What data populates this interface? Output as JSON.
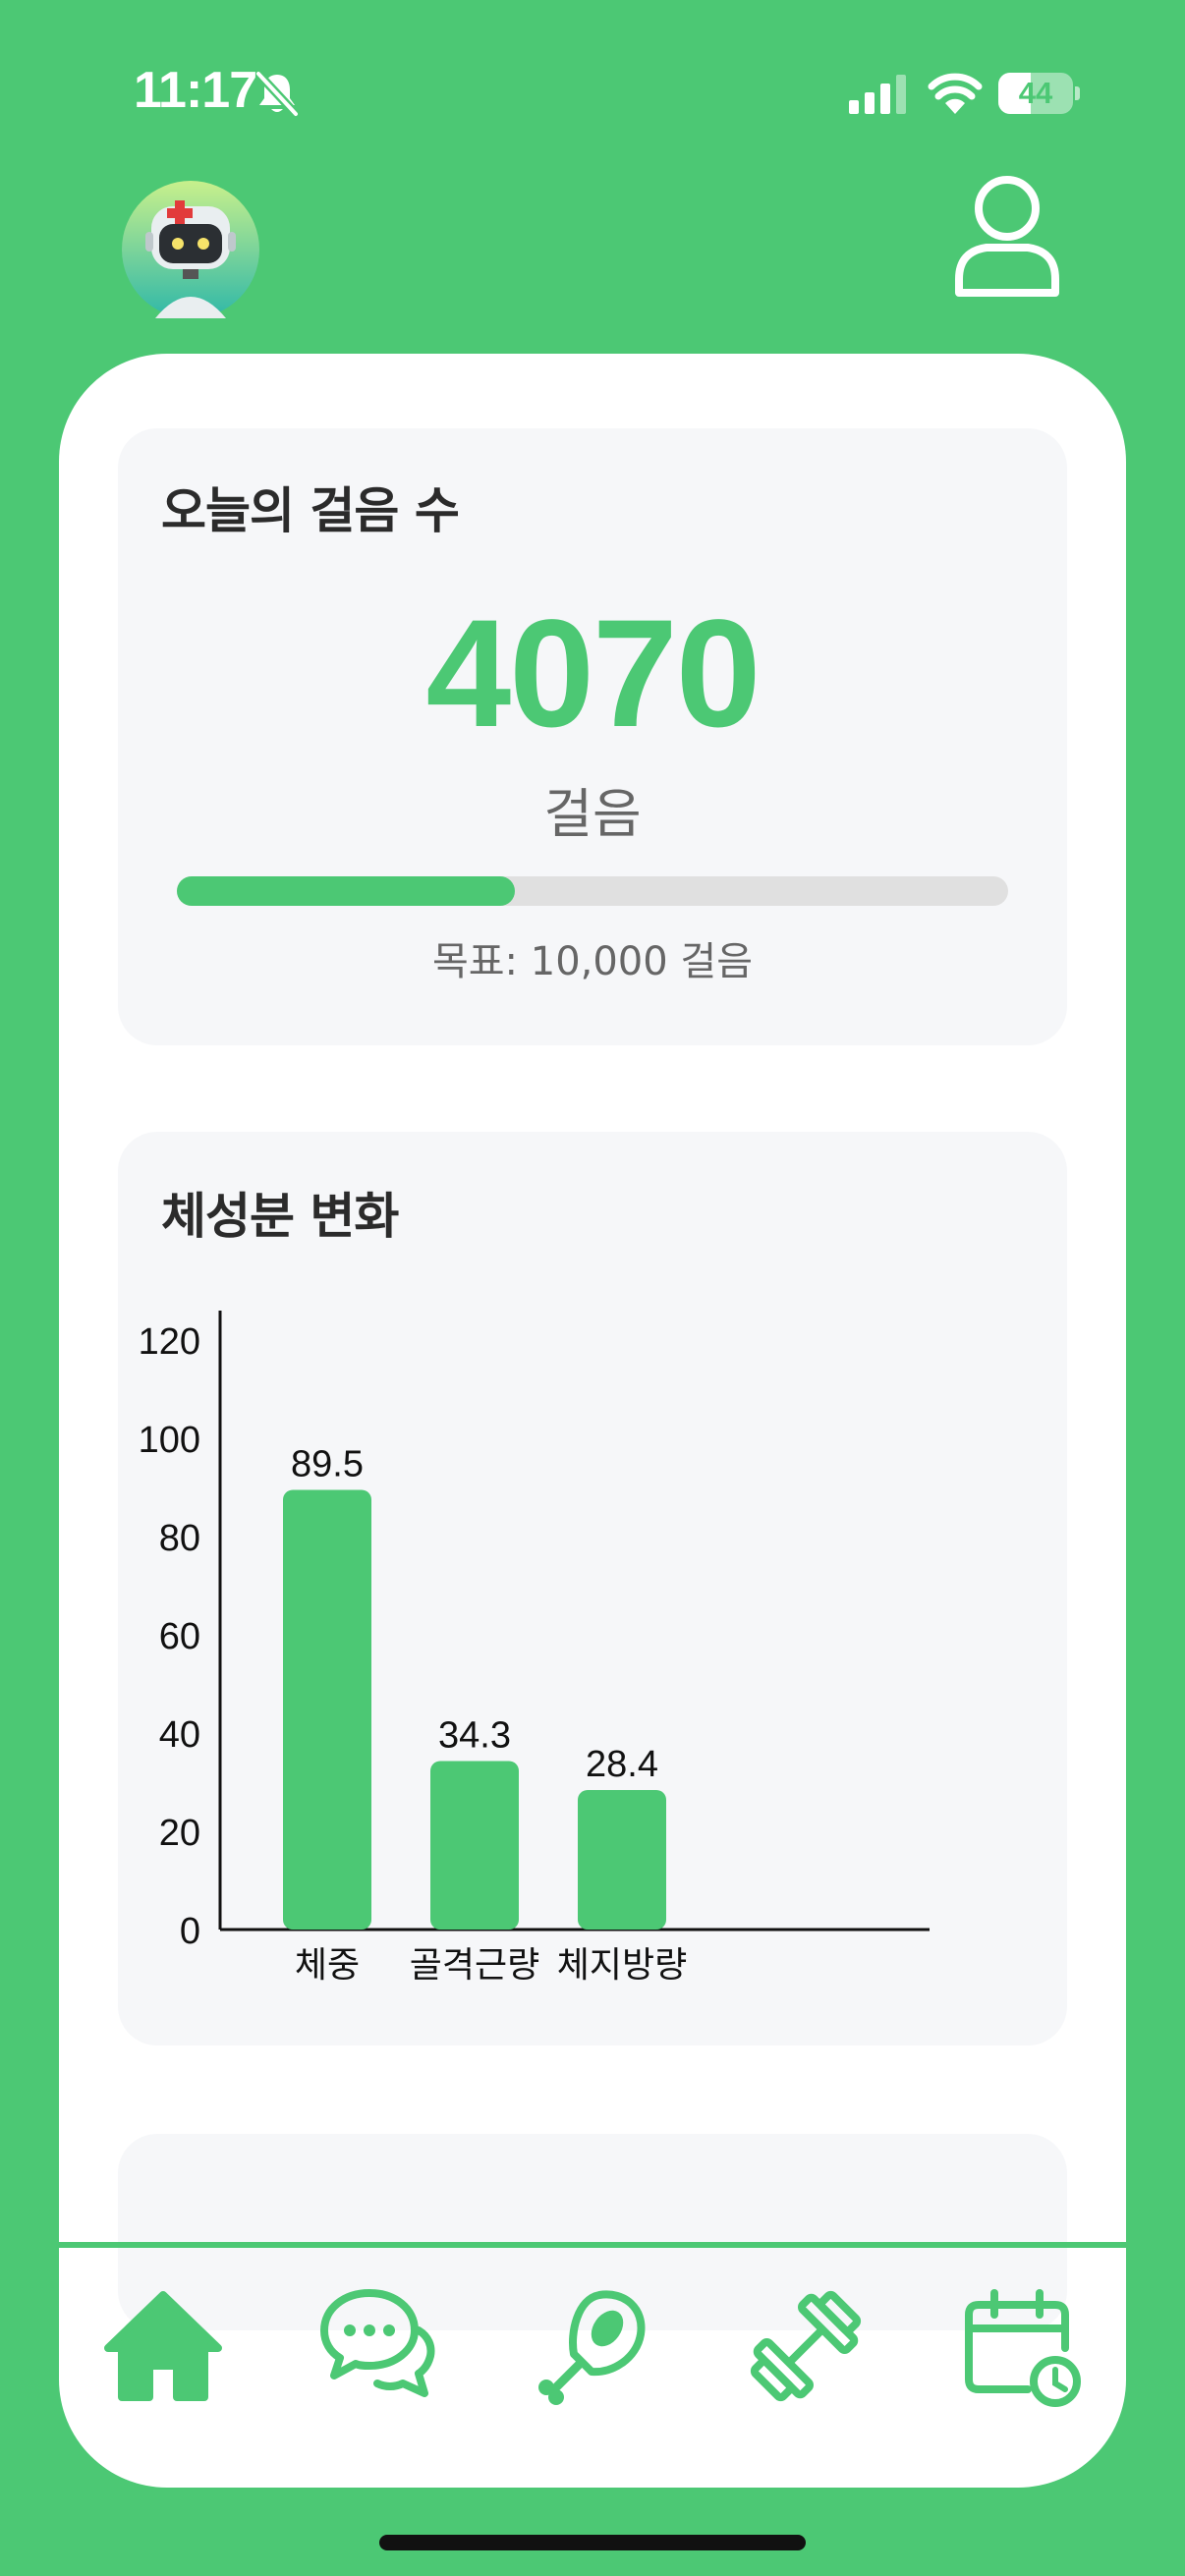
{
  "status_bar": {
    "time": "11:17",
    "battery_level": "44",
    "battery_fraction": 0.44,
    "icons": [
      "bell-slash-icon",
      "cellular-signal-icon",
      "wifi-icon",
      "battery-icon"
    ]
  },
  "header": {
    "left_icon": "robot-doctor-avatar",
    "right_icon": "user-profile-icon"
  },
  "steps_card": {
    "title": "오늘의 걸음 수",
    "count": "4070",
    "unit": "걸음",
    "progress_fraction": 0.407,
    "goal_text": "목표: 10,000 걸음"
  },
  "body_comp_card": {
    "title": "체성분 변화"
  },
  "chart_data": {
    "type": "bar",
    "title": "체성분 변화",
    "categories": [
      "체중",
      "골격근량",
      "체지방량"
    ],
    "values": [
      89.5,
      34.3,
      28.4
    ],
    "value_labels": [
      "89.5",
      "34.3",
      "28.4"
    ],
    "ylim": [
      0,
      120
    ],
    "yticks": [
      "0",
      "20",
      "40",
      "60",
      "80",
      "100",
      "120"
    ],
    "grid": false,
    "legend": "none",
    "bar_color": "#4CC874"
  },
  "bottom_nav": {
    "items": [
      {
        "icon": "home-icon",
        "active": true
      },
      {
        "icon": "chat-bubbles-icon",
        "active": false
      },
      {
        "icon": "meat-drumstick-icon",
        "active": false
      },
      {
        "icon": "dumbbell-icon",
        "active": false
      },
      {
        "icon": "calendar-clock-icon",
        "active": false
      }
    ]
  },
  "colors": {
    "brand_green": "#4CC874",
    "card_bg": "#F6F7F9",
    "text_dark": "#2b2b2b",
    "text_muted": "#666666"
  }
}
